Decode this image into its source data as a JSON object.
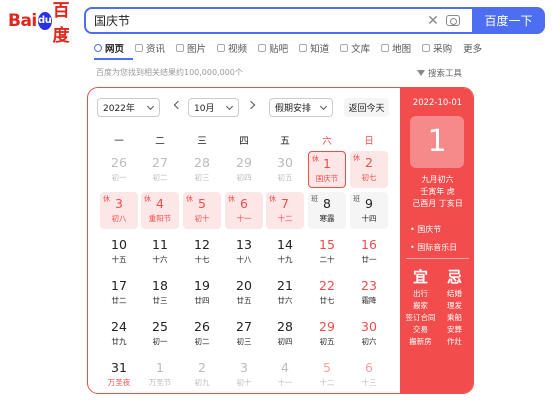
{
  "logo": {
    "part1": "Bai",
    "paw": "du",
    "part2": "百度"
  },
  "search": {
    "query": "国庆节",
    "button": "百度一下"
  },
  "tabs": [
    {
      "label": "网页",
      "icon": "search-icon"
    },
    {
      "label": "资讯",
      "icon": "news-icon"
    },
    {
      "label": "图片",
      "icon": "image-icon"
    },
    {
      "label": "视频",
      "icon": "video-icon"
    },
    {
      "label": "贴吧",
      "icon": "tieba-icon"
    },
    {
      "label": "知道",
      "icon": "question-icon"
    },
    {
      "label": "文库",
      "icon": "document-icon"
    },
    {
      "label": "地图",
      "icon": "map-icon"
    },
    {
      "label": "采购",
      "icon": "cart-icon"
    },
    {
      "label": "更多",
      "icon": ""
    }
  ],
  "result_count": "百度为您找到相关结果约100,000,000个",
  "search_tools": "搜索工具",
  "calendar": {
    "year": "2022年",
    "month": "10月",
    "holiday_select": "假期安排",
    "today_button": "返回今天",
    "weekdays": [
      "一",
      "二",
      "三",
      "四",
      "五",
      "六",
      "日"
    ],
    "days": [
      {
        "n": "26",
        "s": "初一",
        "t": "other"
      },
      {
        "n": "27",
        "s": "初二",
        "t": "other"
      },
      {
        "n": "28",
        "s": "初三",
        "t": "other"
      },
      {
        "n": "29",
        "s": "初四",
        "t": "other"
      },
      {
        "n": "30",
        "s": "初五",
        "t": "other"
      },
      {
        "n": "1",
        "s": "国庆节",
        "t": "rest sel1",
        "tag": "休"
      },
      {
        "n": "2",
        "s": "初七",
        "t": "rest",
        "tag": "休"
      },
      {
        "n": "3",
        "s": "初八",
        "t": "rest",
        "tag": "休"
      },
      {
        "n": "4",
        "s": "重阳节",
        "t": "rest",
        "tag": "休"
      },
      {
        "n": "5",
        "s": "初十",
        "t": "rest",
        "tag": "休"
      },
      {
        "n": "6",
        "s": "十一",
        "t": "rest",
        "tag": "休"
      },
      {
        "n": "7",
        "s": "十二",
        "t": "rest",
        "tag": "休"
      },
      {
        "n": "8",
        "s": "寒露",
        "t": "work",
        "tag": "班"
      },
      {
        "n": "9",
        "s": "十四",
        "t": "work",
        "tag": "班"
      },
      {
        "n": "10",
        "s": "十五",
        "t": ""
      },
      {
        "n": "11",
        "s": "十六",
        "t": ""
      },
      {
        "n": "12",
        "s": "十七",
        "t": ""
      },
      {
        "n": "13",
        "s": "十八",
        "t": ""
      },
      {
        "n": "14",
        "s": "十九",
        "t": ""
      },
      {
        "n": "15",
        "s": "二十",
        "t": "we"
      },
      {
        "n": "16",
        "s": "廿一",
        "t": "we"
      },
      {
        "n": "17",
        "s": "廿二",
        "t": ""
      },
      {
        "n": "18",
        "s": "廿三",
        "t": ""
      },
      {
        "n": "19",
        "s": "廿四",
        "t": ""
      },
      {
        "n": "20",
        "s": "廿五",
        "t": ""
      },
      {
        "n": "21",
        "s": "廿六",
        "t": ""
      },
      {
        "n": "22",
        "s": "廿七",
        "t": "we"
      },
      {
        "n": "23",
        "s": "霜降",
        "t": "we"
      },
      {
        "n": "24",
        "s": "廿九",
        "t": ""
      },
      {
        "n": "25",
        "s": "初一",
        "t": ""
      },
      {
        "n": "26",
        "s": "初二",
        "t": ""
      },
      {
        "n": "27",
        "s": "初三",
        "t": ""
      },
      {
        "n": "28",
        "s": "初四",
        "t": ""
      },
      {
        "n": "29",
        "s": "初五",
        "t": "we"
      },
      {
        "n": "30",
        "s": "初六",
        "t": "we"
      },
      {
        "n": "31",
        "s": "万圣夜",
        "t": "holi"
      },
      {
        "n": "1",
        "s": "万圣节",
        "t": "other"
      },
      {
        "n": "2",
        "s": "初九",
        "t": "other"
      },
      {
        "n": "3",
        "s": "初十",
        "t": "other"
      },
      {
        "n": "4",
        "s": "十一",
        "t": "other"
      },
      {
        "n": "5",
        "s": "十二",
        "t": "other we"
      },
      {
        "n": "6",
        "s": "十三",
        "t": "other we"
      }
    ],
    "detail": {
      "date": "2022-10-01",
      "day": "1",
      "lunar": [
        "九月初六",
        "壬寅年 虎",
        "己酉月 丁亥日"
      ],
      "festivals": [
        "• 国庆节",
        "• 国际音乐日"
      ],
      "yi_title": "宜",
      "ji_title": "忌",
      "yi": [
        "出行",
        "搬家",
        "签订合同",
        "交易",
        "搬新房"
      ],
      "ji": [
        "结婚",
        "理发",
        "乘船",
        "安葬",
        "作灶"
      ]
    }
  },
  "colors": {
    "brand_blue": "#4e6ef2",
    "calendar_red": "#f24c4c"
  }
}
